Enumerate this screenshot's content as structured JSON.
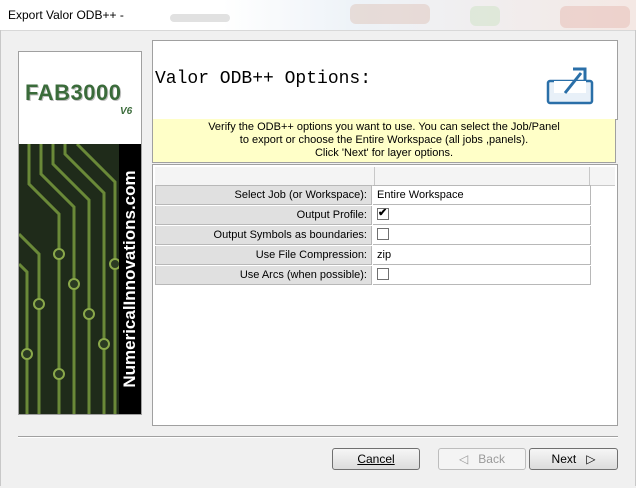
{
  "window": {
    "title": "Export Valor ODB++ -"
  },
  "side_panel": {
    "brand": "FAB3000",
    "version": "V6",
    "vertical_text": "NumericalInnovations.com"
  },
  "header": {
    "title": "Valor ODB++ Options:",
    "icon": "export-icon"
  },
  "info": {
    "line1": "Verify the ODB++ options you want to use.  You can select the Job/Panel",
    "line2": "to export or choose the Entire Workspace (all jobs ,panels).",
    "line3": "Click 'Next' for layer options."
  },
  "options": [
    {
      "label": "Select Job (or Workspace):",
      "type": "text",
      "value": "Entire Workspace"
    },
    {
      "label": "Output Profile:",
      "type": "checkbox",
      "checked": true
    },
    {
      "label": "Output Symbols as boundaries:",
      "type": "checkbox",
      "checked": false
    },
    {
      "label": "Use File Compression:",
      "type": "text",
      "value": "zip"
    },
    {
      "label": "Use Arcs (when possible):",
      "type": "checkbox",
      "checked": false
    }
  ],
  "buttons": {
    "cancel": "Cancel",
    "back": "Back",
    "next": "Next"
  },
  "colors": {
    "info_bg": "#ffffc8",
    "brand_green": "#3a6b3a",
    "icon_blue": "#2a6fa8"
  }
}
